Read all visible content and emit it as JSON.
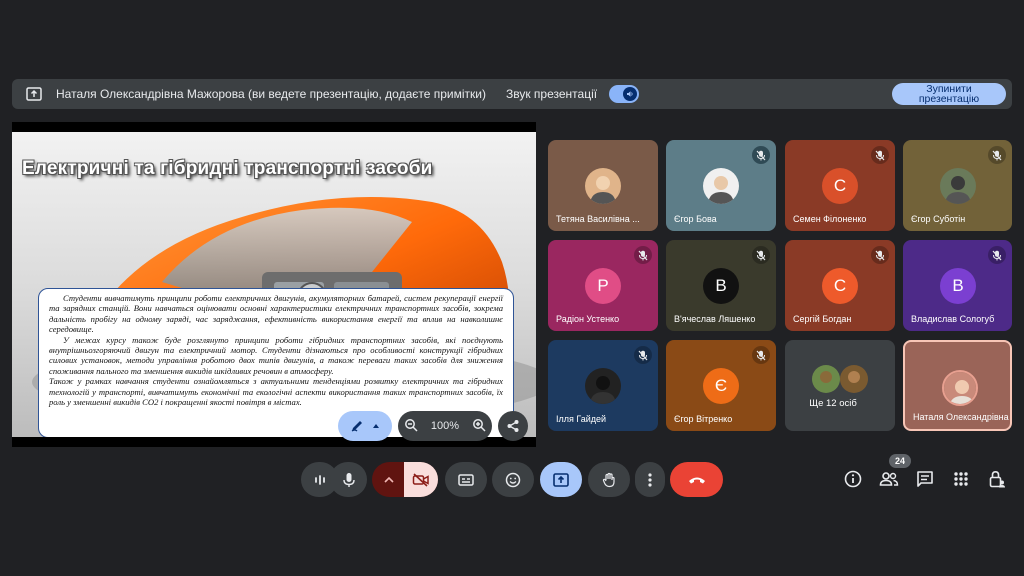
{
  "banner": {
    "text": "Наталя Олександрівна Мажорова (ви ведете презентацію, додаєте примітки)",
    "sound_label": "Звук презентації",
    "stop_label": "Зупинити презентацію"
  },
  "slide": {
    "title": "Електричні та гібридні транспортні засоби",
    "paragraphs": [
      "Студенти вивчатимуть принципи роботи електричних двигунів, акумуляторних батарей, систем рекуперації енергії та зарядних станцій. Вони навчаться оцінювати основні характеристики електричних транспортних засобів, зокрема дальність пробігу на одному заряді, час заряджання, ефективність використання енергії та вплив на навколишнє середовище.",
      "У межах курсу також буде розглянуто принципи роботи гібридних транспортних засобів, які поєднують внутрішньозгоряючий двигун та електричний мотор. Студенти дізнаються про особливості конструкції гібридних силових установок, методи управління роботою двох типів двигунів, а також переваги таких засобів для зниження споживання пального та зменшення викидів шкідливих речовин в атмосферу.",
      "Також у рамках навчання студенти ознайомляться з актуальними тенденціями розвитку електричних та гібридних технологій у транспорті, вивчатимуть економічні та екологічні аспекти використання таких транспортних засобів, їх роль у зменшенні викидів CO2 і покращенні якості повітря в містах."
    ],
    "zoom": "100%"
  },
  "participants": [
    {
      "name": "Тетяна Василівна ...",
      "initial": "",
      "bg": "#7a5a48",
      "muted": false
    },
    {
      "name": "Єгор Бова",
      "initial": "",
      "bg": "#5d7d88",
      "muted": true
    },
    {
      "name": "Семен Філоненко",
      "initial": "С",
      "bg": "#8a3a26",
      "muted": true
    },
    {
      "name": "Єгор Суботін",
      "initial": "",
      "bg": "#726239",
      "muted": true
    },
    {
      "name": "Радіон Устенко",
      "initial": "Р",
      "bg": "#9a2760",
      "muted": true
    },
    {
      "name": "В'ячеслав Ляшенко",
      "initial": "В",
      "bg": "#3a3a2c",
      "muted": true
    },
    {
      "name": "Сергій Богдан",
      "initial": "С",
      "bg": "#8a3a26",
      "muted": true
    },
    {
      "name": "Владислав Сологуб",
      "initial": "В",
      "bg": "#4d2a88",
      "muted": true
    },
    {
      "name": "Ілля Гайдей",
      "initial": "",
      "bg": "#1d3a60",
      "muted": true
    },
    {
      "name": "Єгор Вітренко",
      "initial": "Є",
      "bg": "#8a4a16",
      "muted": true
    },
    {
      "name": "Ще 12 осіб",
      "initial": "",
      "bg": "#3c4043",
      "muted": false
    },
    {
      "name": "Наталя Олександрівна",
      "initial": "",
      "bg": "#9a6458",
      "muted": false
    }
  ],
  "avatar_colors": {
    "Семен Філоненко": "#d9502a",
    "Радіон Устенко": "#e04d86",
    "В'ячеслав Ляшенко": "#111111",
    "Сергій Богдан": "#ee5a2b",
    "Владислав Сологуб": "#7b3fd1",
    "Єгор Вітренко": "#ee6c17"
  },
  "toolbar": {
    "participants_count": "24"
  },
  "colors": {
    "background": "#202124",
    "accent": "#a8c7fa",
    "end_call": "#ea4335"
  }
}
